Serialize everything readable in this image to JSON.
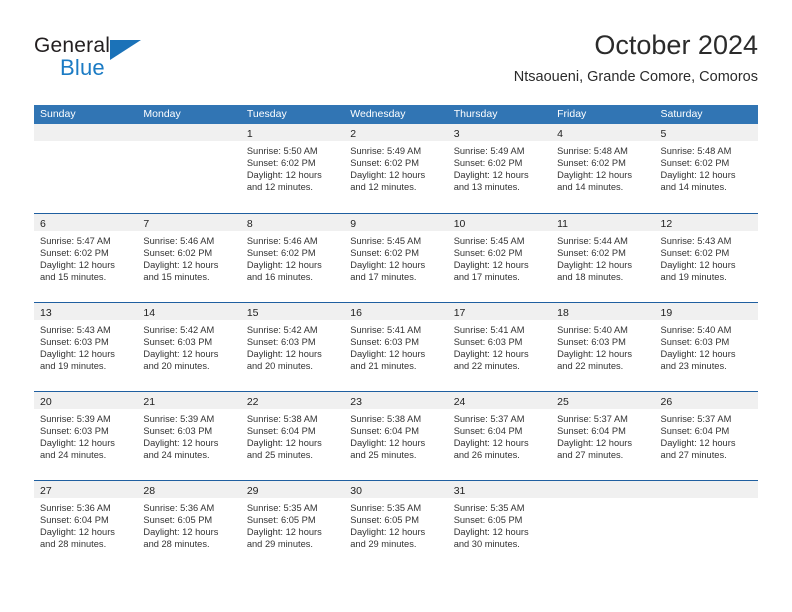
{
  "brand": {
    "name_top": "General",
    "name_bottom": "Blue",
    "triangle_color": "#1b72b8",
    "blue_text_color": "#1b7bc4",
    "top_text_color": "#231f20"
  },
  "header": {
    "title": "October 2024",
    "subtitle": "Ntsaoueni, Grande Comore, Comoros"
  },
  "theme": {
    "header_blue": "#3175b4",
    "separator_blue": "#1f5fa0",
    "day_band_gray": "#f0f0f0",
    "cell_white": "#ffffff"
  },
  "weekdays": [
    "Sunday",
    "Monday",
    "Tuesday",
    "Wednesday",
    "Thursday",
    "Friday",
    "Saturday"
  ],
  "weeks": [
    [
      {
        "day": "",
        "lines": []
      },
      {
        "day": "",
        "lines": []
      },
      {
        "day": "1",
        "lines": [
          "Sunrise: 5:50 AM",
          "Sunset: 6:02 PM",
          "Daylight: 12 hours",
          "and 12 minutes."
        ]
      },
      {
        "day": "2",
        "lines": [
          "Sunrise: 5:49 AM",
          "Sunset: 6:02 PM",
          "Daylight: 12 hours",
          "and 12 minutes."
        ]
      },
      {
        "day": "3",
        "lines": [
          "Sunrise: 5:49 AM",
          "Sunset: 6:02 PM",
          "Daylight: 12 hours",
          "and 13 minutes."
        ]
      },
      {
        "day": "4",
        "lines": [
          "Sunrise: 5:48 AM",
          "Sunset: 6:02 PM",
          "Daylight: 12 hours",
          "and 14 minutes."
        ]
      },
      {
        "day": "5",
        "lines": [
          "Sunrise: 5:48 AM",
          "Sunset: 6:02 PM",
          "Daylight: 12 hours",
          "and 14 minutes."
        ]
      }
    ],
    [
      {
        "day": "6",
        "lines": [
          "Sunrise: 5:47 AM",
          "Sunset: 6:02 PM",
          "Daylight: 12 hours",
          "and 15 minutes."
        ]
      },
      {
        "day": "7",
        "lines": [
          "Sunrise: 5:46 AM",
          "Sunset: 6:02 PM",
          "Daylight: 12 hours",
          "and 15 minutes."
        ]
      },
      {
        "day": "8",
        "lines": [
          "Sunrise: 5:46 AM",
          "Sunset: 6:02 PM",
          "Daylight: 12 hours",
          "and 16 minutes."
        ]
      },
      {
        "day": "9",
        "lines": [
          "Sunrise: 5:45 AM",
          "Sunset: 6:02 PM",
          "Daylight: 12 hours",
          "and 17 minutes."
        ]
      },
      {
        "day": "10",
        "lines": [
          "Sunrise: 5:45 AM",
          "Sunset: 6:02 PM",
          "Daylight: 12 hours",
          "and 17 minutes."
        ]
      },
      {
        "day": "11",
        "lines": [
          "Sunrise: 5:44 AM",
          "Sunset: 6:02 PM",
          "Daylight: 12 hours",
          "and 18 minutes."
        ]
      },
      {
        "day": "12",
        "lines": [
          "Sunrise: 5:43 AM",
          "Sunset: 6:02 PM",
          "Daylight: 12 hours",
          "and 19 minutes."
        ]
      }
    ],
    [
      {
        "day": "13",
        "lines": [
          "Sunrise: 5:43 AM",
          "Sunset: 6:03 PM",
          "Daylight: 12 hours",
          "and 19 minutes."
        ]
      },
      {
        "day": "14",
        "lines": [
          "Sunrise: 5:42 AM",
          "Sunset: 6:03 PM",
          "Daylight: 12 hours",
          "and 20 minutes."
        ]
      },
      {
        "day": "15",
        "lines": [
          "Sunrise: 5:42 AM",
          "Sunset: 6:03 PM",
          "Daylight: 12 hours",
          "and 20 minutes."
        ]
      },
      {
        "day": "16",
        "lines": [
          "Sunrise: 5:41 AM",
          "Sunset: 6:03 PM",
          "Daylight: 12 hours",
          "and 21 minutes."
        ]
      },
      {
        "day": "17",
        "lines": [
          "Sunrise: 5:41 AM",
          "Sunset: 6:03 PM",
          "Daylight: 12 hours",
          "and 22 minutes."
        ]
      },
      {
        "day": "18",
        "lines": [
          "Sunrise: 5:40 AM",
          "Sunset: 6:03 PM",
          "Daylight: 12 hours",
          "and 22 minutes."
        ]
      },
      {
        "day": "19",
        "lines": [
          "Sunrise: 5:40 AM",
          "Sunset: 6:03 PM",
          "Daylight: 12 hours",
          "and 23 minutes."
        ]
      }
    ],
    [
      {
        "day": "20",
        "lines": [
          "Sunrise: 5:39 AM",
          "Sunset: 6:03 PM",
          "Daylight: 12 hours",
          "and 24 minutes."
        ]
      },
      {
        "day": "21",
        "lines": [
          "Sunrise: 5:39 AM",
          "Sunset: 6:03 PM",
          "Daylight: 12 hours",
          "and 24 minutes."
        ]
      },
      {
        "day": "22",
        "lines": [
          "Sunrise: 5:38 AM",
          "Sunset: 6:04 PM",
          "Daylight: 12 hours",
          "and 25 minutes."
        ]
      },
      {
        "day": "23",
        "lines": [
          "Sunrise: 5:38 AM",
          "Sunset: 6:04 PM",
          "Daylight: 12 hours",
          "and 25 minutes."
        ]
      },
      {
        "day": "24",
        "lines": [
          "Sunrise: 5:37 AM",
          "Sunset: 6:04 PM",
          "Daylight: 12 hours",
          "and 26 minutes."
        ]
      },
      {
        "day": "25",
        "lines": [
          "Sunrise: 5:37 AM",
          "Sunset: 6:04 PM",
          "Daylight: 12 hours",
          "and 27 minutes."
        ]
      },
      {
        "day": "26",
        "lines": [
          "Sunrise: 5:37 AM",
          "Sunset: 6:04 PM",
          "Daylight: 12 hours",
          "and 27 minutes."
        ]
      }
    ],
    [
      {
        "day": "27",
        "lines": [
          "Sunrise: 5:36 AM",
          "Sunset: 6:04 PM",
          "Daylight: 12 hours",
          "and 28 minutes."
        ]
      },
      {
        "day": "28",
        "lines": [
          "Sunrise: 5:36 AM",
          "Sunset: 6:05 PM",
          "Daylight: 12 hours",
          "and 28 minutes."
        ]
      },
      {
        "day": "29",
        "lines": [
          "Sunrise: 5:35 AM",
          "Sunset: 6:05 PM",
          "Daylight: 12 hours",
          "and 29 minutes."
        ]
      },
      {
        "day": "30",
        "lines": [
          "Sunrise: 5:35 AM",
          "Sunset: 6:05 PM",
          "Daylight: 12 hours",
          "and 29 minutes."
        ]
      },
      {
        "day": "31",
        "lines": [
          "Sunrise: 5:35 AM",
          "Sunset: 6:05 PM",
          "Daylight: 12 hours",
          "and 30 minutes."
        ]
      },
      {
        "day": "",
        "lines": []
      },
      {
        "day": "",
        "lines": []
      }
    ]
  ]
}
